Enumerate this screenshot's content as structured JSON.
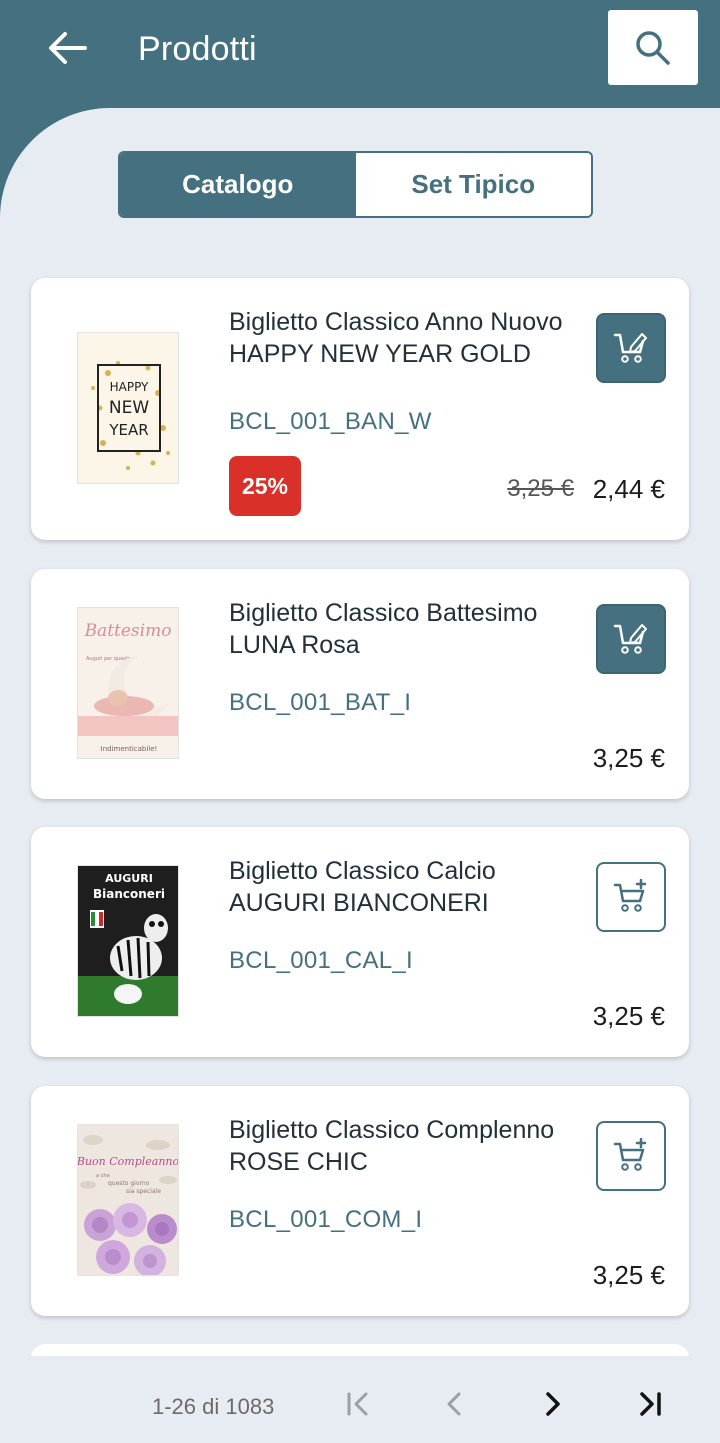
{
  "appbar": {
    "title": "Prodotti",
    "back_icon": "arrow-left-icon",
    "search_icon": "search-icon"
  },
  "tabs": [
    {
      "label": "Catalogo",
      "active": true
    },
    {
      "label": "Set Tipico",
      "active": false
    }
  ],
  "products": [
    {
      "name": "Biglietto Classico Anno Nuovo HAPPY NEW YEAR GOLD",
      "sku": "BCL_001_BAN_W",
      "discount_badge": "25%",
      "old_price": "3,25 €",
      "price": "2,44 €",
      "cart_icon": "cart-edit-icon",
      "thumb_text": [
        "HAPPY",
        "NEW",
        "YEAR"
      ]
    },
    {
      "name": "Biglietto Classico Battesimo LUNA Rosa",
      "sku": "BCL_001_BAT_I",
      "price": "3,25 €",
      "cart_icon": "cart-edit-icon",
      "thumb_text": [
        "Battesimo",
        "Auguri per questo giorno...",
        "Indimenticabile!"
      ]
    },
    {
      "name": "Biglietto Classico Calcio AUGURI BIANCONERI",
      "sku": "BCL_001_CAL_I",
      "price": "3,25 €",
      "cart_icon": "cart-add-icon",
      "thumb_text": [
        "AUGURI",
        "Bianconeri"
      ]
    },
    {
      "name": "Biglietto Classico Complenno ROSE CHIC",
      "sku": "BCL_001_COM_I",
      "price": "3,25 €",
      "cart_icon": "cart-add-icon",
      "thumb_text": [
        "Buon Compleanno",
        "a che",
        "questo giorno",
        "sia speciale"
      ]
    }
  ],
  "pagination": {
    "label": "1-26 di 1083",
    "first_icon": "first-page-icon",
    "prev_icon": "chevron-left-icon",
    "next_icon": "chevron-right-icon",
    "last_icon": "last-page-icon"
  },
  "colors": {
    "primary": "#44707f",
    "background": "#e7ecf2",
    "discount": "#d9302a"
  }
}
